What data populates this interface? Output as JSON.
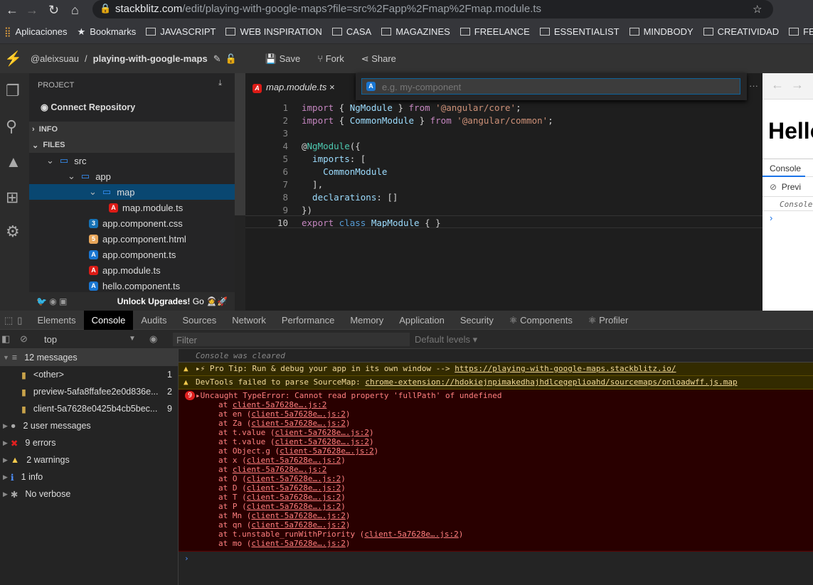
{
  "browser": {
    "url_host": "stackblitz.com",
    "url_path": "/edit/playing-with-google-maps?file=src%2Fapp%2Fmap%2Fmap.module.ts"
  },
  "bookmarks": [
    "Aplicaciones",
    "Bookmarks",
    "JAVASCRIPT",
    "WEB INSPIRATION",
    "CASA",
    "MAGAZINES",
    "FREELANCE",
    "ESSENTIALIST",
    "MINDBODY",
    "CREATIVIDAD",
    "FESTA"
  ],
  "header": {
    "user": "@aleixsuau",
    "sep": "/",
    "project": "playing-with-google-maps",
    "save": "Save",
    "fork": "Fork",
    "share": "Share"
  },
  "sidebar": {
    "project": "PROJECT",
    "connect": "Connect Repository",
    "info": "INFO",
    "files": "FILES",
    "footer": "Unlock Upgrades!",
    "go": "Go",
    "tree": [
      {
        "name": "src",
        "type": "folder"
      },
      {
        "name": "app",
        "type": "folder"
      },
      {
        "name": "map",
        "type": "folder"
      },
      {
        "name": "map.module.ts",
        "type": "angular-red"
      },
      {
        "name": "app.component.css",
        "type": "css"
      },
      {
        "name": "app.component.html",
        "type": "html"
      },
      {
        "name": "app.component.ts",
        "type": "angular-blue"
      },
      {
        "name": "app.module.ts",
        "type": "angular-red"
      },
      {
        "name": "hello.component.ts",
        "type": "angular-blue"
      }
    ]
  },
  "editor": {
    "tab": "map.module.ts",
    "quick_input_placeholder": "e.g. my-component",
    "lines": [
      [
        [
          "kw",
          "import"
        ],
        [
          "pl",
          " { "
        ],
        [
          "id",
          "NgModule"
        ],
        [
          "pl",
          " } "
        ],
        [
          "kw",
          "from"
        ],
        [
          "str",
          " '@angular/core'"
        ],
        [
          "pl",
          ";"
        ]
      ],
      [
        [
          "kw",
          "import"
        ],
        [
          "pl",
          " { "
        ],
        [
          "id",
          "CommonModule"
        ],
        [
          "pl",
          " } "
        ],
        [
          "kw",
          "from"
        ],
        [
          "str",
          " '@angular/common'"
        ],
        [
          "pl",
          ";"
        ]
      ],
      [],
      [
        [
          "pl",
          "@"
        ],
        [
          "dec",
          "NgModule"
        ],
        [
          "pl",
          "({"
        ]
      ],
      [
        [
          "id",
          "  imports"
        ],
        [
          "pl",
          ": ["
        ]
      ],
      [
        [
          "id",
          "    CommonModule"
        ]
      ],
      [
        [
          "pl",
          "  ],"
        ]
      ],
      [
        [
          "id",
          "  declarations"
        ],
        [
          "pl",
          ": []"
        ]
      ],
      [
        [
          "pl",
          "})"
        ]
      ],
      [
        [
          "kw",
          "export"
        ],
        [
          "kb",
          " class"
        ],
        [
          "id",
          " MapModule"
        ],
        [
          "pl",
          " { }"
        ]
      ]
    ]
  },
  "preview": {
    "heading": "Hello",
    "console_tab": "Console",
    "preview_label": "Previ",
    "console_cleared": "Console"
  },
  "devtools": {
    "tabs": [
      "Elements",
      "Console",
      "Audits",
      "Sources",
      "Network",
      "Performance",
      "Memory",
      "Application",
      "Security",
      "⚛ Components",
      "⚛ Profiler"
    ],
    "active_tab": "Console",
    "context": "top",
    "filter_placeholder": "Filter",
    "levels": "Default levels ▾",
    "sidebar": [
      {
        "label": "12 messages",
        "count": ""
      },
      {
        "label": "<other>",
        "count": "1"
      },
      {
        "label": "preview-5afa8ffafee2e0d836e...",
        "count": "2"
      },
      {
        "label": "client-5a7628e0425b4cb5bec...",
        "count": "9"
      },
      {
        "label": "2 user messages",
        "count": ""
      },
      {
        "label": "9 errors",
        "count": ""
      },
      {
        "label": "2 warnings",
        "count": ""
      },
      {
        "label": "1 info",
        "count": ""
      },
      {
        "label": "No verbose",
        "count": ""
      }
    ],
    "console": {
      "cleared": "Console was cleared",
      "tip": "▸⚡ Pro Tip: Run & debug your app in its own window --> ",
      "tip_link": "https://playing-with-google-maps.stackblitz.io/",
      "sourcemap": "DevTools failed to parse SourceMap: ",
      "sourcemap_link": "chrome-extension://hdokiejnpimakedhajhdlcegeplioahd/sourcemaps/onloadwff.js.map",
      "error_count": "9",
      "error": "▸Uncaught TypeError: Cannot read property 'fullPath' of undefined",
      "stack": [
        [
          "",
          ""
        ],
        [
          "en",
          ""
        ],
        [
          "Za",
          ""
        ],
        [
          "t.value",
          ""
        ],
        [
          "t.value",
          ""
        ],
        [
          "Object.g",
          ""
        ],
        [
          "x",
          ""
        ],
        [
          "",
          ""
        ],
        [
          "O",
          ""
        ],
        [
          "D",
          ""
        ],
        [
          "T",
          ""
        ],
        [
          "P",
          ""
        ],
        [
          "Mn",
          ""
        ],
        [
          "qn",
          ""
        ],
        [
          "t.unstable_runWithPriority",
          ""
        ],
        [
          "mo",
          ""
        ]
      ],
      "stack_link": "client-5a7628e….js:2"
    }
  }
}
